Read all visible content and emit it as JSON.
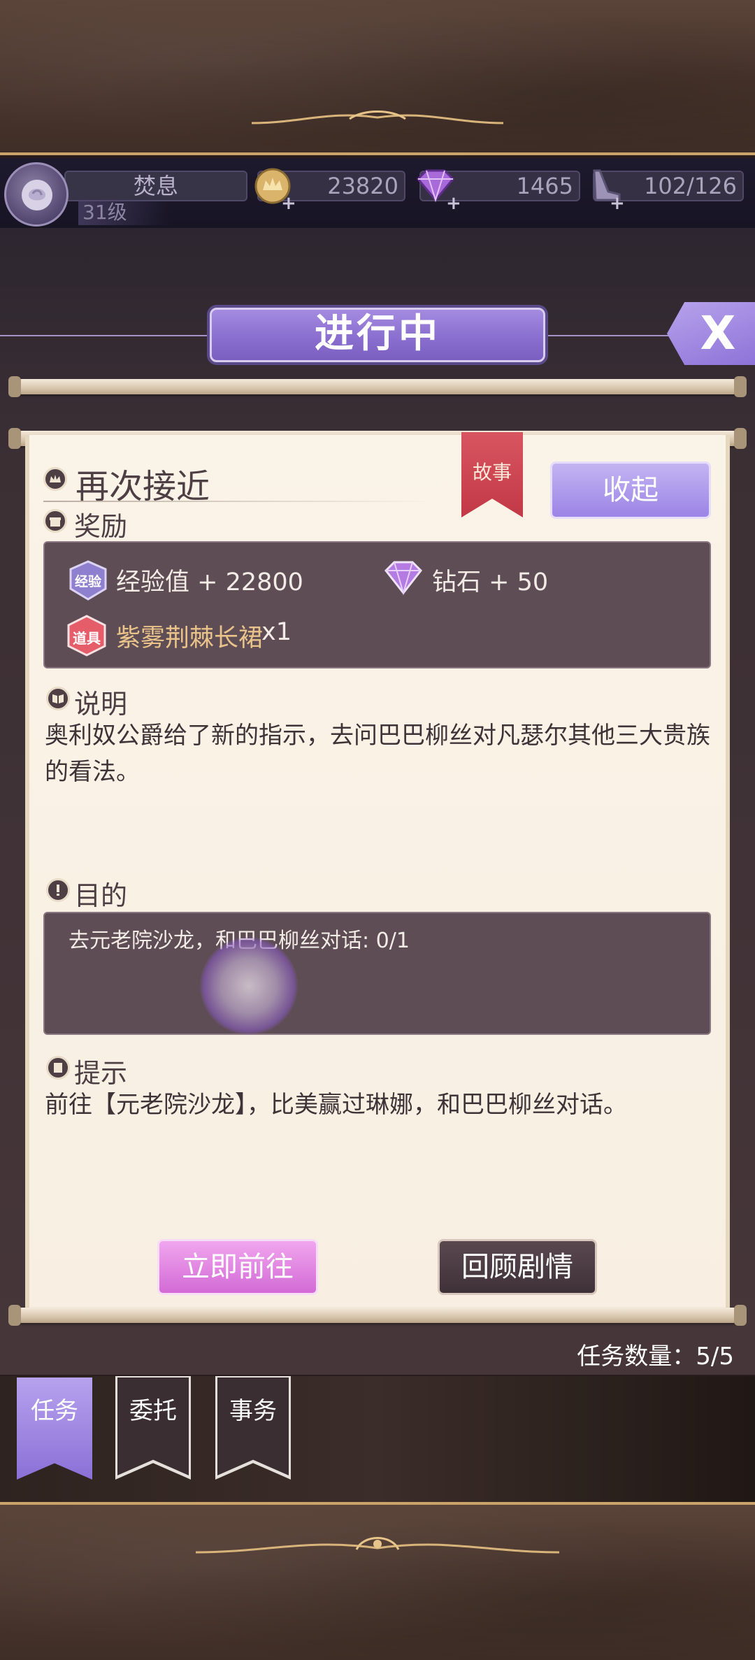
{
  "player": {
    "name": "焚息",
    "level": "31级"
  },
  "resources": {
    "gold": "23820",
    "diamond": "1465",
    "stamina": "102/126"
  },
  "panel": {
    "title": "进行中",
    "close_label": "X"
  },
  "quest": {
    "title": "再次接近",
    "tag": "故事",
    "collapse_label": "收起"
  },
  "reward": {
    "section_label": "奖励",
    "exp_badge": "经验",
    "exp_text": "经验值 + 22800",
    "diamond_text": "钻石 + 50",
    "item_badge": "道具",
    "item_name": "紫雾荆棘长裙",
    "item_qty": "x1"
  },
  "description": {
    "section_label": "说明",
    "text": "奥利奴公爵给了新的指示，去问巴巴柳丝对凡瑟尔其他三大贵族的看法。"
  },
  "goal": {
    "section_label": "目的",
    "text": "去元老院沙龙，和巴巴柳丝对话: 0/1"
  },
  "hint": {
    "section_label": "提示",
    "text": "前往【元老院沙龙】，比美赢过琳娜，和巴巴柳丝对话。"
  },
  "actions": {
    "go_label": "立即前往",
    "review_label": "回顾剧情"
  },
  "task_count": "任务数量：5/5",
  "tabs": [
    {
      "label": "任务",
      "active": true
    },
    {
      "label": "委托",
      "active": false
    },
    {
      "label": "事务",
      "active": false
    }
  ],
  "colors": {
    "accent_purple": "#8a6fcf",
    "ribbon_red": "#c23846",
    "parchment": "#faf3e7",
    "dark_box": "#5e4d55",
    "item_gold": "#e9c38a"
  }
}
